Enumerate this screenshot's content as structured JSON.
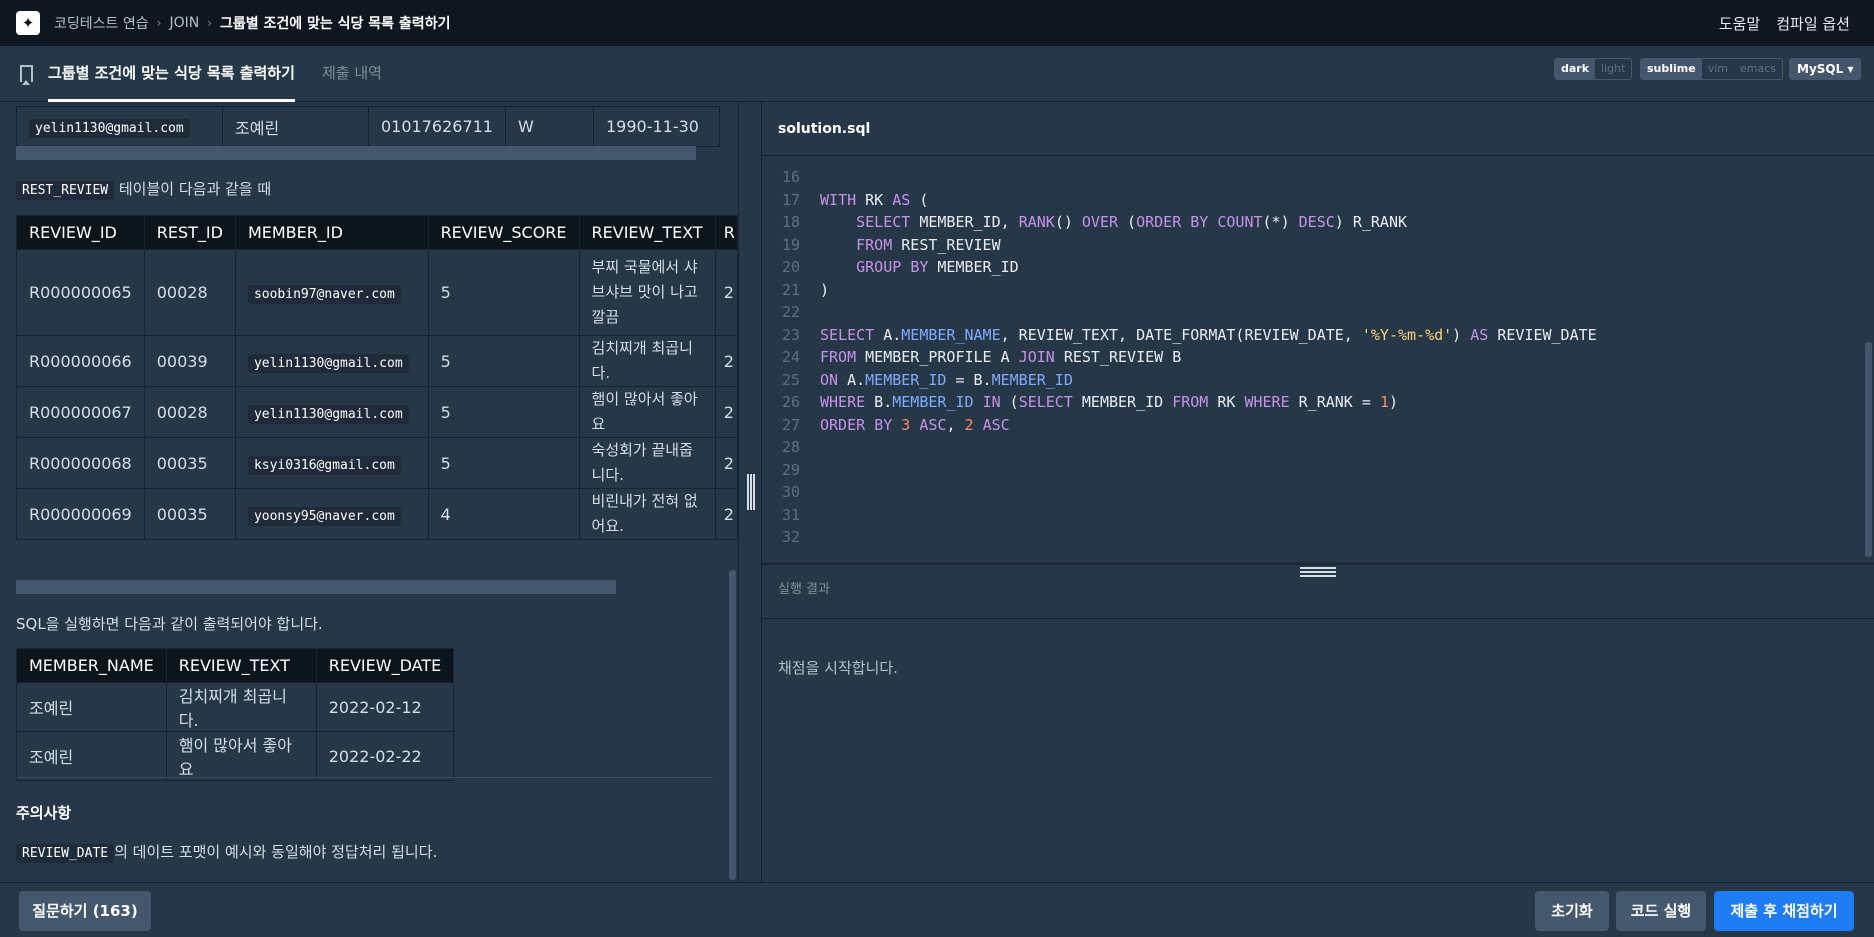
{
  "topnav": {
    "crumbs": [
      "코딩테스트 연습",
      "JOIN",
      "그룹별 조건에 맞는 식당 목록 출력하기"
    ],
    "help": "도움말",
    "compile_options": "컴파일 옵션"
  },
  "tabs": {
    "active": "그룹별 조건에 맞는 식당 목록 출력하기",
    "inactive": "제출 내역"
  },
  "theme": {
    "dark": "dark",
    "light": "light"
  },
  "keymap": {
    "sublime": "sublime",
    "vim": "vim",
    "emacs": "emacs"
  },
  "language": "MySQL",
  "member_row": {
    "email": "yelin1130@gmail.com",
    "name": "조예린",
    "phone": "01017626711",
    "gender": "W",
    "birth": "1990-11-30"
  },
  "rest_review_label": {
    "table": "REST_REVIEW",
    "suffix": "테이블이 다음과 같을 때"
  },
  "review_table": {
    "headers": [
      "REVIEW_ID",
      "REST_ID",
      "MEMBER_ID",
      "REVIEW_SCORE",
      "REVIEW_TEXT",
      "R"
    ],
    "rows": [
      {
        "id": "R000000065",
        "rest": "00028",
        "member": "soobin97@naver.com",
        "score": "5",
        "text": "부찌 국물에서 샤브샤브 맛이 나고 깔끔",
        "cut": "2"
      },
      {
        "id": "R000000066",
        "rest": "00039",
        "member": "yelin1130@gmail.com",
        "score": "5",
        "text": "김치찌개 최곱니다.",
        "cut": "2"
      },
      {
        "id": "R000000067",
        "rest": "00028",
        "member": "yelin1130@gmail.com",
        "score": "5",
        "text": "햄이 많아서 좋아요",
        "cut": "2"
      },
      {
        "id": "R000000068",
        "rest": "00035",
        "member": "ksyi0316@gmail.com",
        "score": "5",
        "text": "숙성회가 끝내줍니다.",
        "cut": "2"
      },
      {
        "id": "R000000069",
        "rest": "00035",
        "member": "yoonsy95@naver.com",
        "score": "4",
        "text": "비린내가 전혀 없어요.",
        "cut": "2"
      }
    ]
  },
  "expected_label": "SQL을 실행하면 다음과 같이 출력되어야 합니다.",
  "expected_table": {
    "headers": [
      "MEMBER_NAME",
      "REVIEW_TEXT",
      "REVIEW_DATE"
    ],
    "rows": [
      [
        "조예린",
        "김치찌개 최곱니다.",
        "2022-02-12"
      ],
      [
        "조예린",
        "햄이 많아서 좋아요",
        "2022-02-22"
      ]
    ]
  },
  "notes": {
    "title": "주의사항",
    "chip": "REVIEW_DATE",
    "text": "의 데이트 포맷이 예시와 동일해야 정답처리 됩니다."
  },
  "editor": {
    "filename": "solution.sql",
    "line_numbers": [
      "16",
      "17",
      "18",
      "19",
      "20",
      "21",
      "22",
      "23",
      "24",
      "25",
      "26",
      "27",
      "28",
      "29",
      "30",
      "31",
      "32"
    ],
    "lines": [
      "",
      "WITH RK AS (",
      "    SELECT MEMBER_ID, RANK() OVER (ORDER BY COUNT(*) DESC) R_RANK",
      "    FROM REST_REVIEW",
      "    GROUP BY MEMBER_ID",
      ")",
      "",
      "SELECT A.MEMBER_NAME, REVIEW_TEXT, DATE_FORMAT(REVIEW_DATE, '%Y-%m-%d') AS REVIEW_DATE",
      "FROM MEMBER_PROFILE A JOIN REST_REVIEW B",
      "ON A.MEMBER_ID = B.MEMBER_ID",
      "WHERE B.MEMBER_ID IN (SELECT MEMBER_ID FROM RK WHERE R_RANK = 1)",
      "ORDER BY 3 ASC, 2 ASC",
      "",
      "",
      "",
      "",
      ""
    ]
  },
  "result": {
    "title": "실행 결과",
    "message": "채점을 시작합니다."
  },
  "footer": {
    "ask": "질문하기 (163)",
    "reset": "초기화",
    "run": "코드 실행",
    "submit": "제출 후 채점하기"
  }
}
